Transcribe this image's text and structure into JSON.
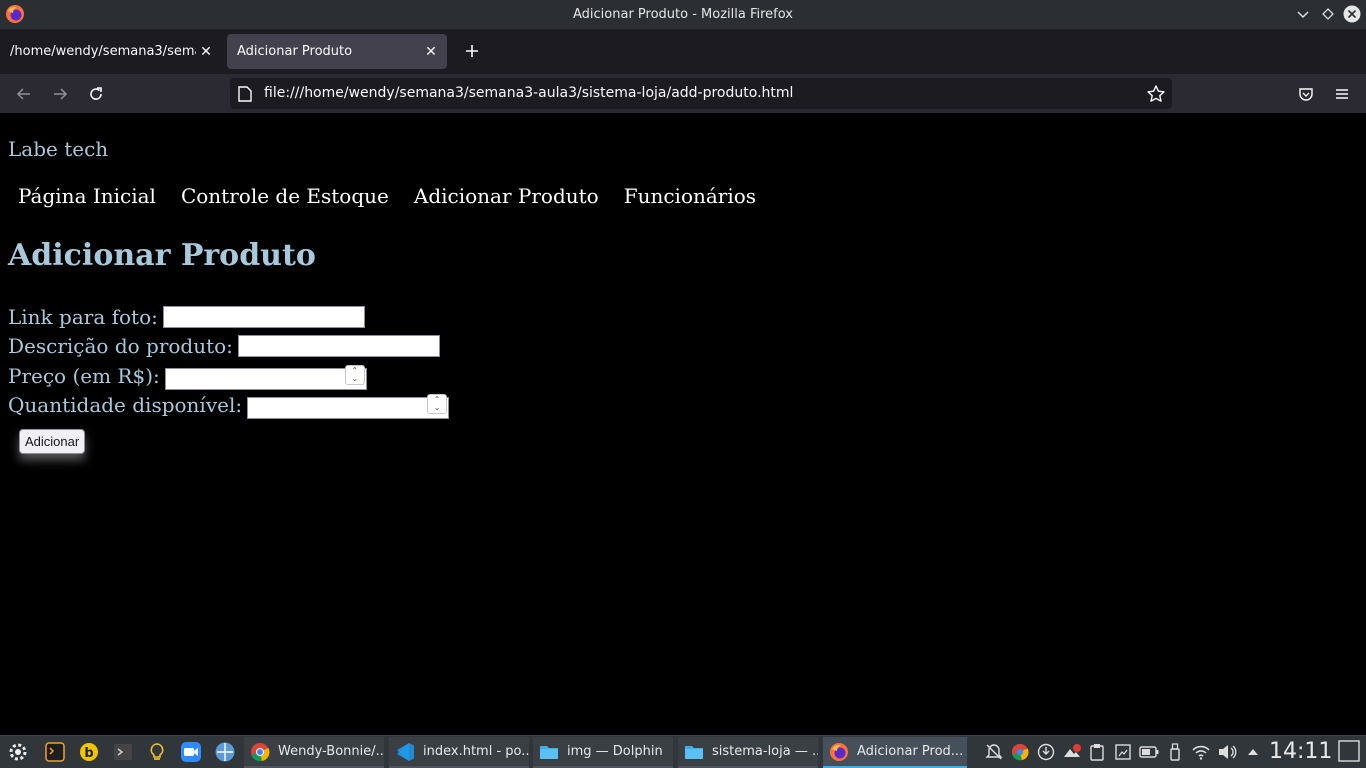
{
  "window": {
    "title": "Adicionar Produto - Mozilla Firefox"
  },
  "tabs": [
    {
      "label": "/home/wendy/semana3/sema",
      "active": false
    },
    {
      "label": "Adicionar Produto",
      "active": true
    }
  ],
  "navbar": {
    "url": "file:///home/wendy/semana3/semana3-aula3/sistema-loja/add-produto.html"
  },
  "page": {
    "brand": "Labe tech",
    "menu": [
      "Página Inicial",
      "Controle de Estoque",
      "Adicionar Produto",
      "Funcionários"
    ],
    "heading": "Adicionar Produto",
    "form": {
      "photo_label": "Link para foto:",
      "description_label": "Descrição do produto:",
      "price_label": "Preço (em R$):",
      "quantity_label": "Quantidade disponível:",
      "photo_value": "",
      "description_value": "",
      "price_value": "",
      "quantity_value": "",
      "submit_label": "Adicionar"
    },
    "colors": {
      "background": "#000000",
      "accent_text": "#a8c9dc",
      "menu_text": "#ffffff"
    }
  },
  "taskbar": {
    "tasks": [
      {
        "label": "Wendy-Bonnie/...",
        "icon": "chrome-icon"
      },
      {
        "label": "index.html - po...",
        "icon": "vscode-icon"
      },
      {
        "label": "img — Dolphin",
        "icon": "folder-icon"
      },
      {
        "label": "sistema-loja — ...",
        "icon": "folder-icon"
      },
      {
        "label": "Adicionar Prod...",
        "icon": "firefox-icon"
      }
    ],
    "clock": "14:11"
  }
}
